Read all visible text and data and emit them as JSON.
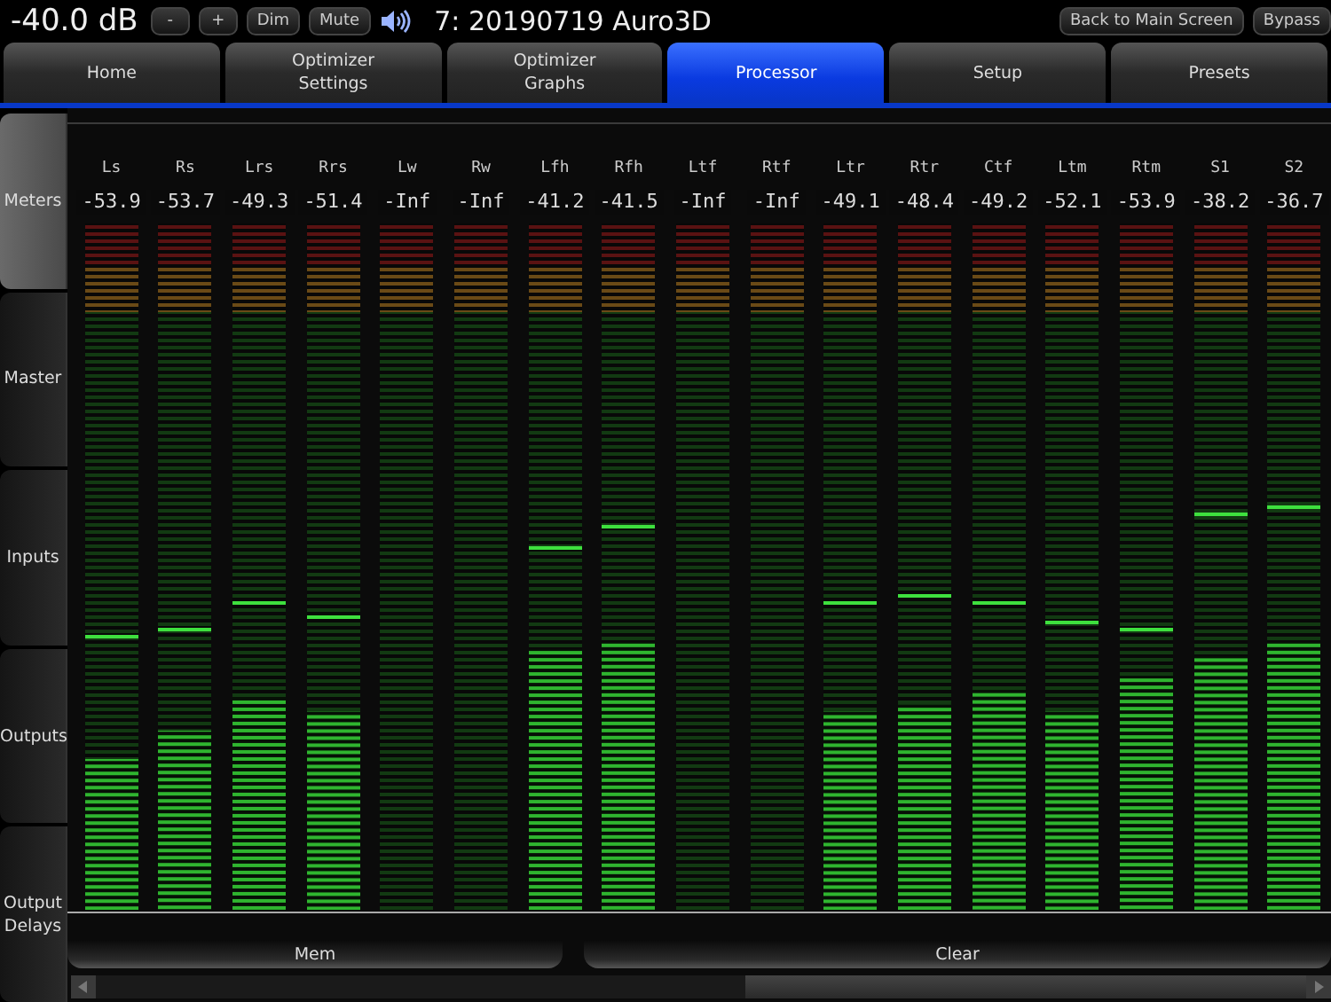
{
  "header": {
    "volume": "-40.0 dB",
    "buttons": [
      "-",
      "+",
      "Dim",
      "Mute"
    ],
    "preset_name": "7: 20190719 Auro3D",
    "right_buttons": [
      "Back to Main Screen",
      "Bypass"
    ]
  },
  "tabs": [
    {
      "label": "Home",
      "selected": false
    },
    {
      "label": "Optimizer\nSettings",
      "selected": false
    },
    {
      "label": "Optimizer\nGraphs",
      "selected": false
    },
    {
      "label": "Processor",
      "selected": true
    },
    {
      "label": "Setup",
      "selected": false
    },
    {
      "label": "Presets",
      "selected": false
    }
  ],
  "side_tabs": [
    {
      "label": "Meters",
      "selected": true
    },
    {
      "label": "Master",
      "selected": false
    },
    {
      "label": "Inputs",
      "selected": false
    },
    {
      "label": "Outputs",
      "selected": false
    },
    {
      "label": "Output\nDelays",
      "selected": false
    }
  ],
  "meters": [
    {
      "name": "Ls",
      "reading": "-53.9",
      "level": 0.22,
      "peak": {
        "level": 0.4
      }
    },
    {
      "name": "Rs",
      "reading": "-53.7",
      "level": 0.26,
      "peak": {
        "level": 0.41
      }
    },
    {
      "name": "Lrs",
      "reading": "-49.3",
      "level": 0.31,
      "peak": {
        "level": 0.45
      }
    },
    {
      "name": "Rrs",
      "reading": "-51.4",
      "level": 0.29,
      "peak": {
        "level": 0.43
      }
    },
    {
      "name": "Lw",
      "reading": "-Inf",
      "level": 0
    },
    {
      "name": "Rw",
      "reading": "-Inf",
      "level": 0
    },
    {
      "name": "Lfh",
      "reading": "-41.2",
      "level": 0.38,
      "peak": {
        "level": 0.53
      }
    },
    {
      "name": "Rfh",
      "reading": "-41.5",
      "level": 0.39,
      "peak": {
        "level": 0.56
      }
    },
    {
      "name": "Ltf",
      "reading": "-Inf",
      "level": 0
    },
    {
      "name": "Rtf",
      "reading": "-Inf",
      "level": 0
    },
    {
      "name": "Ltr",
      "reading": "-49.1",
      "level": 0.29,
      "peak": {
        "level": 0.45
      }
    },
    {
      "name": "Rtr",
      "reading": "-48.4",
      "level": 0.3,
      "peak": {
        "level": 0.46
      }
    },
    {
      "name": "Ctf",
      "reading": "-49.2",
      "level": 0.32,
      "peak": {
        "level": 0.45
      }
    },
    {
      "name": "Ltm",
      "reading": "-52.1",
      "level": 0.29,
      "peak": {
        "level": 0.42
      }
    },
    {
      "name": "Rtm",
      "reading": "-53.9",
      "level": 0.34,
      "peak": {
        "level": 0.41
      }
    },
    {
      "name": "S1",
      "reading": "-38.2",
      "level": 0.37,
      "peak": {
        "level": 0.58
      }
    },
    {
      "name": "S2",
      "reading": "-36.7",
      "level": 0.39,
      "peak": {
        "level": 0.59
      }
    }
  ],
  "buttons": [
    "Mem",
    "Clear"
  ]
}
